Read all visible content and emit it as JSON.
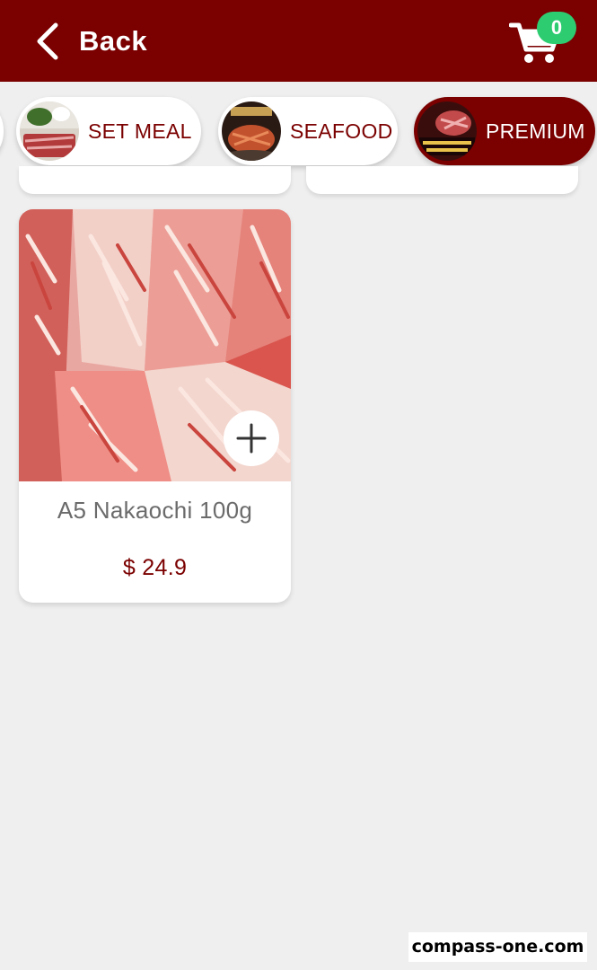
{
  "header": {
    "back_label": "Back",
    "cart_count": "0"
  },
  "categories": [
    {
      "label": "SET MEAL",
      "active": false
    },
    {
      "label": "SEAFOOD",
      "active": false
    },
    {
      "label": "PREMIUM",
      "active": true
    }
  ],
  "products": [
    {
      "name": "A5 Nakaochi 100g",
      "price": "$ 24.9"
    }
  ],
  "watermark": "compass-one.com",
  "colors": {
    "brand": "#7b0000",
    "badge": "#2ecc71",
    "background": "#efefef"
  }
}
